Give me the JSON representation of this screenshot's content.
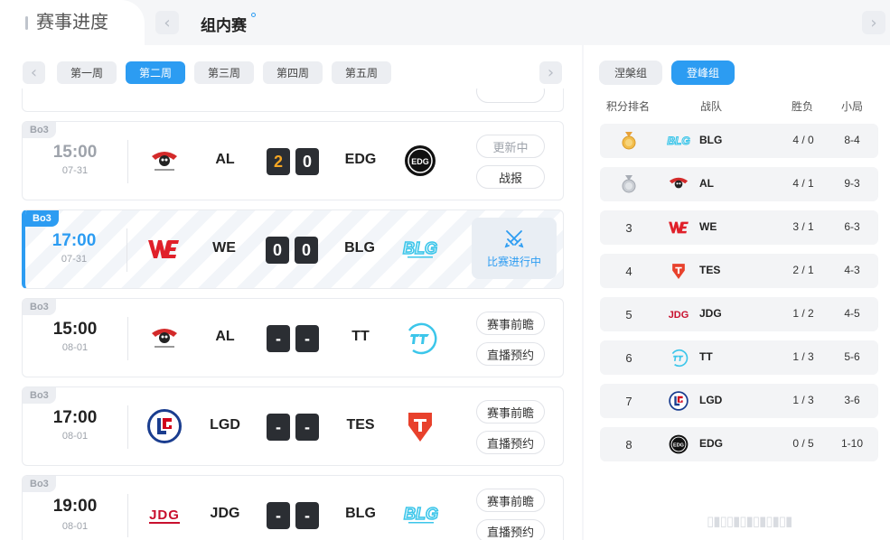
{
  "header": {
    "title": "赛事进度",
    "subtitle": "组内赛"
  },
  "weeks": [
    "第一周",
    "第二周",
    "第三周",
    "第四周",
    "第五周"
  ],
  "active_week": 1,
  "matches": [
    {
      "bo": "Bo3",
      "time": "15:00",
      "date": "07-31",
      "team_a": "AL",
      "team_b": "EDG",
      "score_a": "2",
      "score_b": "0",
      "buttons": [
        "更新中",
        "战报"
      ],
      "status": "finished"
    },
    {
      "bo": "Bo3",
      "time": "17:00",
      "date": "07-31",
      "team_a": "WE",
      "team_b": "BLG",
      "score_a": "0",
      "score_b": "0",
      "live_label": "比赛进行中",
      "status": "live"
    },
    {
      "bo": "Bo3",
      "time": "15:00",
      "date": "08-01",
      "team_a": "AL",
      "team_b": "TT",
      "score_a": "-",
      "score_b": "-",
      "buttons": [
        "赛事前瞻",
        "直播预约"
      ],
      "status": "upcoming"
    },
    {
      "bo": "Bo3",
      "time": "17:00",
      "date": "08-01",
      "team_a": "LGD",
      "team_b": "TES",
      "score_a": "-",
      "score_b": "-",
      "buttons": [
        "赛事前瞻",
        "直播预约"
      ],
      "status": "upcoming"
    },
    {
      "bo": "Bo3",
      "time": "19:00",
      "date": "08-01",
      "team_a": "JDG",
      "team_b": "BLG",
      "score_a": "-",
      "score_b": "-",
      "buttons": [
        "赛事前瞻",
        "直播预约"
      ],
      "status": "upcoming"
    }
  ],
  "groups": [
    "涅槃组",
    "登峰组"
  ],
  "active_group": 1,
  "standings_headers": [
    "积分排名",
    "战队",
    "胜负",
    "小局"
  ],
  "standings": [
    {
      "rank": "1",
      "medal": "gold",
      "team": "BLG",
      "wl": "4 / 0",
      "games": "8-4"
    },
    {
      "rank": "2",
      "medal": "silver",
      "team": "AL",
      "wl": "4 / 1",
      "games": "9-3"
    },
    {
      "rank": "3",
      "team": "WE",
      "wl": "3 / 1",
      "games": "6-3"
    },
    {
      "rank": "4",
      "team": "TES",
      "wl": "2 / 1",
      "games": "4-3"
    },
    {
      "rank": "5",
      "team": "JDG",
      "wl": "1 / 2",
      "games": "4-5"
    },
    {
      "rank": "6",
      "team": "TT",
      "wl": "1 / 3",
      "games": "5-6"
    },
    {
      "rank": "7",
      "team": "LGD",
      "wl": "1 / 3",
      "games": "3-6"
    },
    {
      "rank": "8",
      "team": "EDG",
      "wl": "0 / 5",
      "games": "1-10"
    }
  ],
  "logo_text": {
    "blg": "BLG",
    "edg": "EDG",
    "jdg": "JDG"
  },
  "watermark": "▯▮▯▯▮▯▮▯▮▯▮▯▮",
  "colors": {
    "accent": "#2c9cf2",
    "win": "#f5a623",
    "we_red": "#e0202a",
    "tes_red": "#e8412c",
    "jdg_red": "#c8102e",
    "lgd_blue": "#1a3d8f",
    "blg_cyan": "#3cc6ea"
  }
}
